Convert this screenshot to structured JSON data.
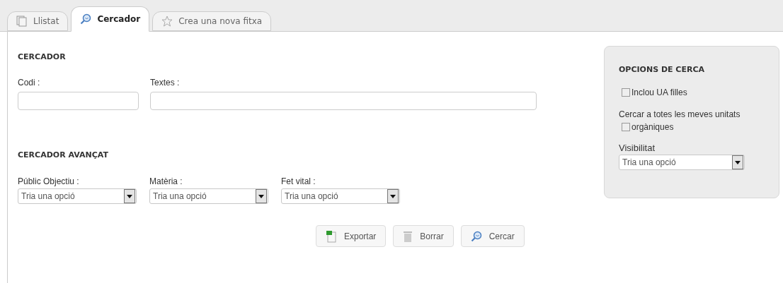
{
  "tabs": [
    {
      "label": "Llistat",
      "kind": "list",
      "selected": false
    },
    {
      "label": "Cercador",
      "kind": "search",
      "selected": true
    },
    {
      "label": "Crea una nova fitxa",
      "kind": "star",
      "selected": false
    }
  ],
  "search": {
    "title": "CERCADOR",
    "fields": [
      {
        "label": "Codi :"
      },
      {
        "label": "Textes :"
      }
    ]
  },
  "advanced": {
    "title": "CERCADOR AVANÇAT",
    "selects": [
      {
        "label": "Públic Objectiu :",
        "value": "Tria una opció"
      },
      {
        "label": "Matèria :",
        "value": "Tria una opció"
      },
      {
        "label": "Fet vital :",
        "value": "Tria una opció"
      }
    ]
  },
  "buttons": [
    {
      "label": "Exportar",
      "kind": "export"
    },
    {
      "label": "Borrar",
      "kind": "trash"
    },
    {
      "label": "Cercar",
      "kind": "search"
    }
  ],
  "options": {
    "title": "OPCIONS DE CERCA",
    "include_children": {
      "label": "Inclou UA filles",
      "checked": false
    },
    "all_units": {
      "text": "Cercar a totes les meves unitats",
      "label": "orgàniques",
      "checked": false
    },
    "visibility": {
      "label": "Visibilitat",
      "value": "Tria una opció"
    }
  }
}
